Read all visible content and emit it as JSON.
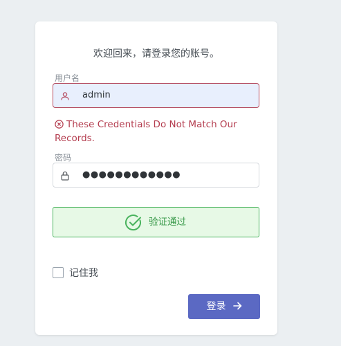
{
  "welcome_text": "欢迎回来，请登录您的账号。",
  "username": {
    "label": "用户名",
    "value": "admin",
    "icon": "user-icon"
  },
  "error": {
    "icon": "error-circle-icon",
    "message": "These Credentials Do Not Match Our Records."
  },
  "password": {
    "label": "密码",
    "value": "●●●●●●●●●●●●",
    "icon": "lock-icon"
  },
  "verification": {
    "icon": "check-circle-icon",
    "text": "验证通过"
  },
  "remember": {
    "label": "记住我",
    "checked": false
  },
  "login_button": {
    "label": "登录",
    "icon": "arrow-right-icon"
  },
  "colors": {
    "primary": "#5b69c3",
    "error": "#b43d4f",
    "success": "#49b35d",
    "background": "#ebeff2"
  }
}
